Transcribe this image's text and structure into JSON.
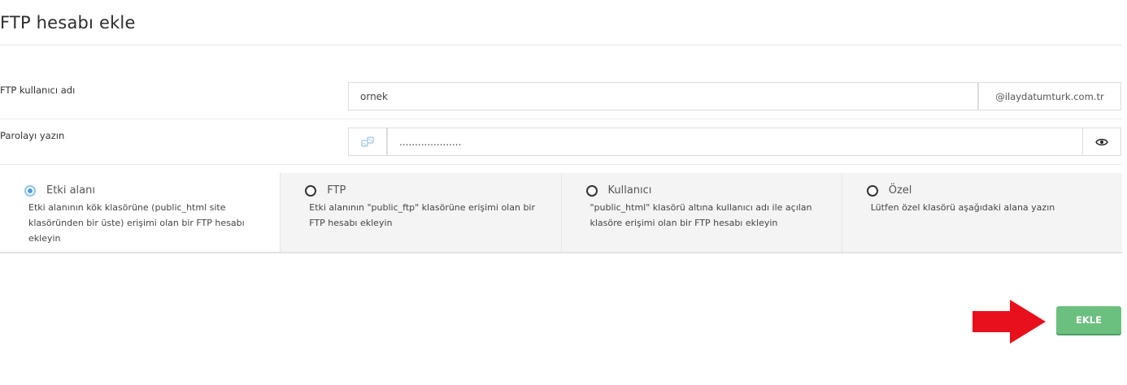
{
  "page": {
    "title": "FTP hesabı ekle"
  },
  "username_row": {
    "label": "FTP kullanıcı adı",
    "value": "ornek",
    "domain_suffix": "@ilaydatumturk.com.tr"
  },
  "password_row": {
    "label": "Parolayı yazın",
    "value": "....................",
    "generate_icon": "dice-icon",
    "toggle_icon": "eye-icon"
  },
  "options": [
    {
      "title": "Etki alanı",
      "description": "Etki alanının kök klasörüne (public_html site klasöründen bir üste) erişimi olan bir FTP hesabı ekleyin",
      "selected": true
    },
    {
      "title": "FTP",
      "description": "Etki alanının \"public_ftp\" klasörüne erişimi olan bir FTP hesabı ekleyin",
      "selected": false
    },
    {
      "title": "Kullanıcı",
      "description": "\"public_html\" klasörü altına kullanıcı adı ile açılan klasöre erişimi olan bir FTP hesabı ekleyin",
      "selected": false
    },
    {
      "title": "Özel",
      "description": "Lütfen özel klasörü aşağıdaki alana yazın",
      "selected": false
    }
  ],
  "actions": {
    "submit_label": "EKLE"
  },
  "colors": {
    "submit": "#6cc07f",
    "arrow": "#e8101c",
    "radio_selected": "#4d9de0"
  }
}
